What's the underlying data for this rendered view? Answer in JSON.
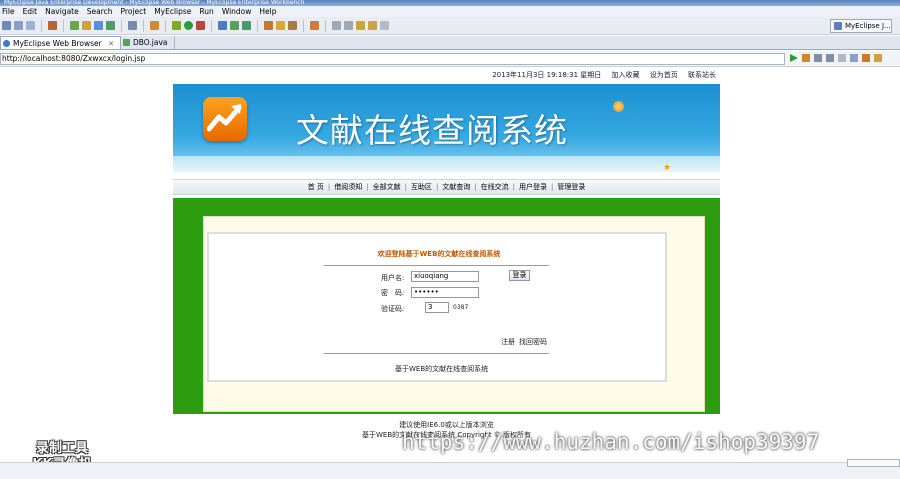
{
  "window": {
    "title": "MyEclipse Java Enterprise Development - MyEclipse Web Browser - MyEclipse Enterprise Workbench"
  },
  "menu": [
    "File",
    "Edit",
    "Navigate",
    "Search",
    "Project",
    "MyEclipse",
    "Run",
    "Window",
    "Help"
  ],
  "perspective": {
    "label": "MyEclipse J..."
  },
  "tabs": [
    {
      "label": "MyEclipse Web Browser",
      "close": "✕"
    },
    {
      "label": "DBO.java",
      "close": ""
    }
  ],
  "address": {
    "url": "http://localhost:8080/Zxwxcx/login.jsp"
  },
  "page": {
    "topinfo": {
      "date": "2013年11月3日 19:18:31 星期日",
      "favorite": "加入收藏",
      "homepage": "设为首页",
      "contact": "联系站长"
    },
    "banner": {
      "title": "文献在线查阅系统"
    },
    "nav": [
      "首 页",
      "借阅须知",
      "全部文献",
      "互助区",
      "文献查询",
      "在线交流",
      "用户登录",
      "管理登录"
    ],
    "form": {
      "title": "欢迎登陆基于WEB的文献在线查阅系统",
      "username_label": "用户名:",
      "username_value": "xiuoqiang",
      "password_label": "密　码:",
      "password_value": "••••••",
      "captcha_label": "验证码:",
      "captcha_value": "3",
      "captcha_code": "0387",
      "login_button": "登录",
      "register_link": "注册",
      "forgot_link": "找回密码",
      "bottom_text": "基于WEB的文献在线查阅系统"
    },
    "footer": {
      "line1": "建议使用IE6.0或以上版本浏览",
      "line2": "基于WEB的文献在线查阅系统 Copyright © 版权所有"
    }
  },
  "watermark": {
    "url": "https://www.huzhan.com/ishop39397",
    "line1": "录制工具",
    "line2": "KK录像机"
  },
  "colors": {
    "banner": "#1b8fd0",
    "green": "#2e9c0f",
    "form_title": "#c05800"
  }
}
